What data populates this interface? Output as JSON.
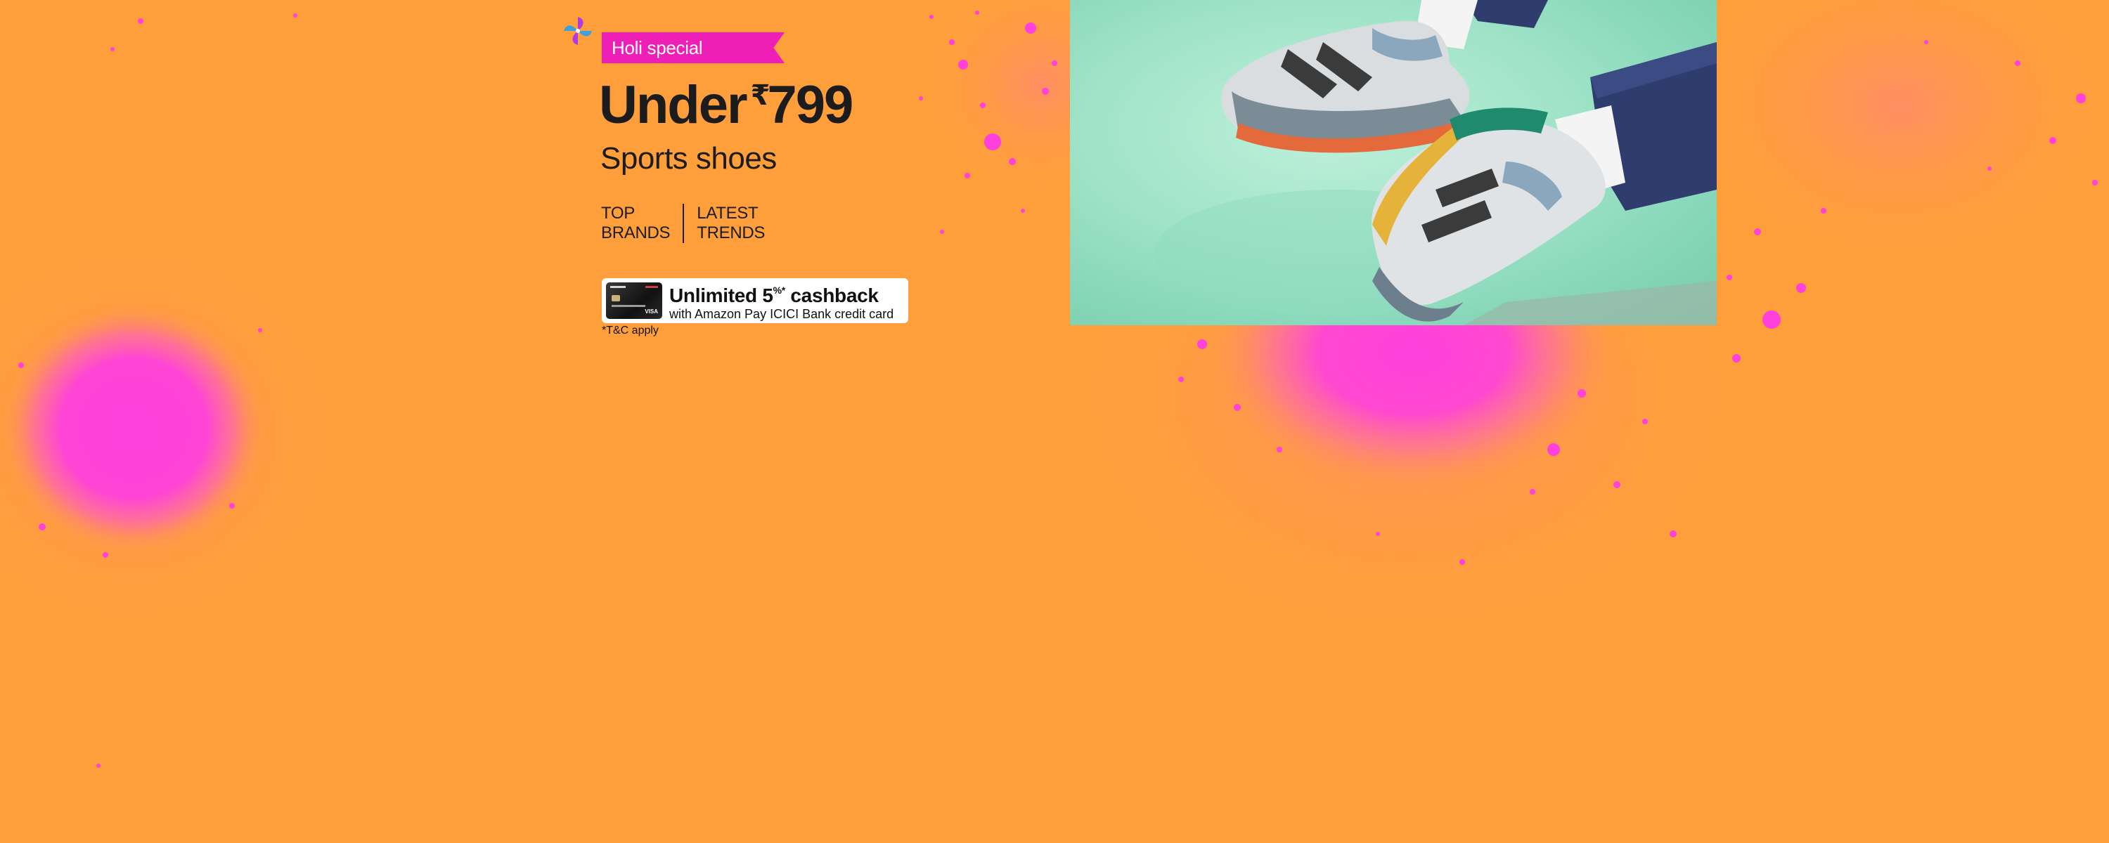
{
  "banner": {
    "tag": "Holi special",
    "headline_prefix": "Under",
    "currency_symbol": "₹",
    "price": "799",
    "subheading": "Sports shoes",
    "tagline_left": [
      "TOP",
      "BRANDS"
    ],
    "tagline_right": [
      "LATEST",
      "TRENDS"
    ],
    "offer": {
      "title_main": "Unlimited 5",
      "title_sup": "%*",
      "title_rest": " cashback",
      "subtitle": "with Amazon Pay ICICI Bank credit card",
      "card_icon": "credit-card-icon"
    },
    "terms": "*T&C apply",
    "icons": {
      "pinwheel": "pinwheel-icon"
    },
    "colors": {
      "background": "#FF9F3B",
      "splash": "#FF40DD",
      "tag": "#EE1FB7",
      "text": "#1C1C1C"
    },
    "image": {
      "description_name": "sneakers-photo"
    }
  }
}
